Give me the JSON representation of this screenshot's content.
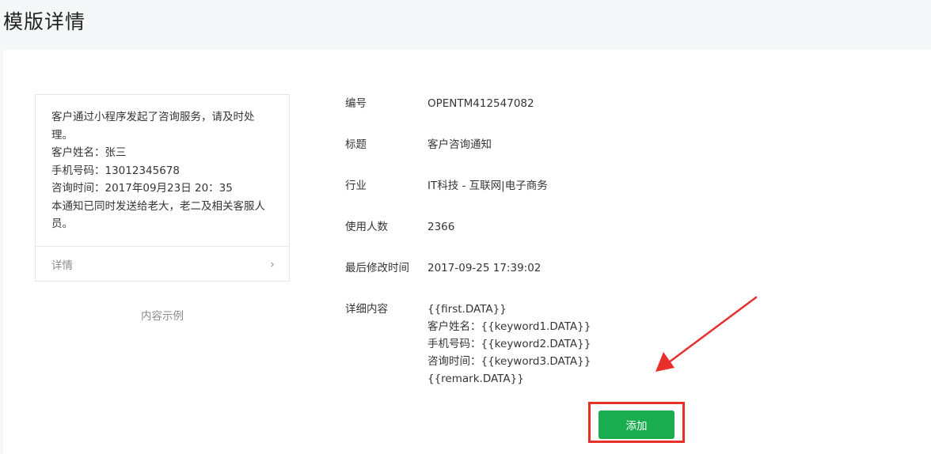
{
  "page": {
    "title": "模版详情"
  },
  "preview": {
    "lines": [
      "客户通过小程序发起了咨询服务，请及时处理。",
      "客户姓名：张三",
      "手机号码：13012345678",
      "咨询时间：2017年09月23日 20：35",
      "本通知已同时发送给老大，老二及相关客服人员。"
    ],
    "footer_label": "详情",
    "caption": "内容示例"
  },
  "info": {
    "id_label": "编号",
    "id_value": "OPENTM412547082",
    "title_label": "标题",
    "title_value": "客户咨询通知",
    "industry_label": "行业",
    "industry_value": "IT科技 - 互联网|电子商务",
    "users_label": "使用人数",
    "users_value": "2366",
    "modified_label": "最后修改时间",
    "modified_value": "2017-09-25 17:39:02",
    "detail_label": "详细内容",
    "detail_lines": [
      "{{first.DATA}}",
      "客户姓名：{{keyword1.DATA}}",
      "手机号码：{{keyword2.DATA}}",
      "咨询时间：{{keyword3.DATA}}",
      "{{remark.DATA}}"
    ]
  },
  "actions": {
    "add_label": "添加"
  },
  "colors": {
    "accent": "#1aad50",
    "annotation": "#e8302b"
  }
}
